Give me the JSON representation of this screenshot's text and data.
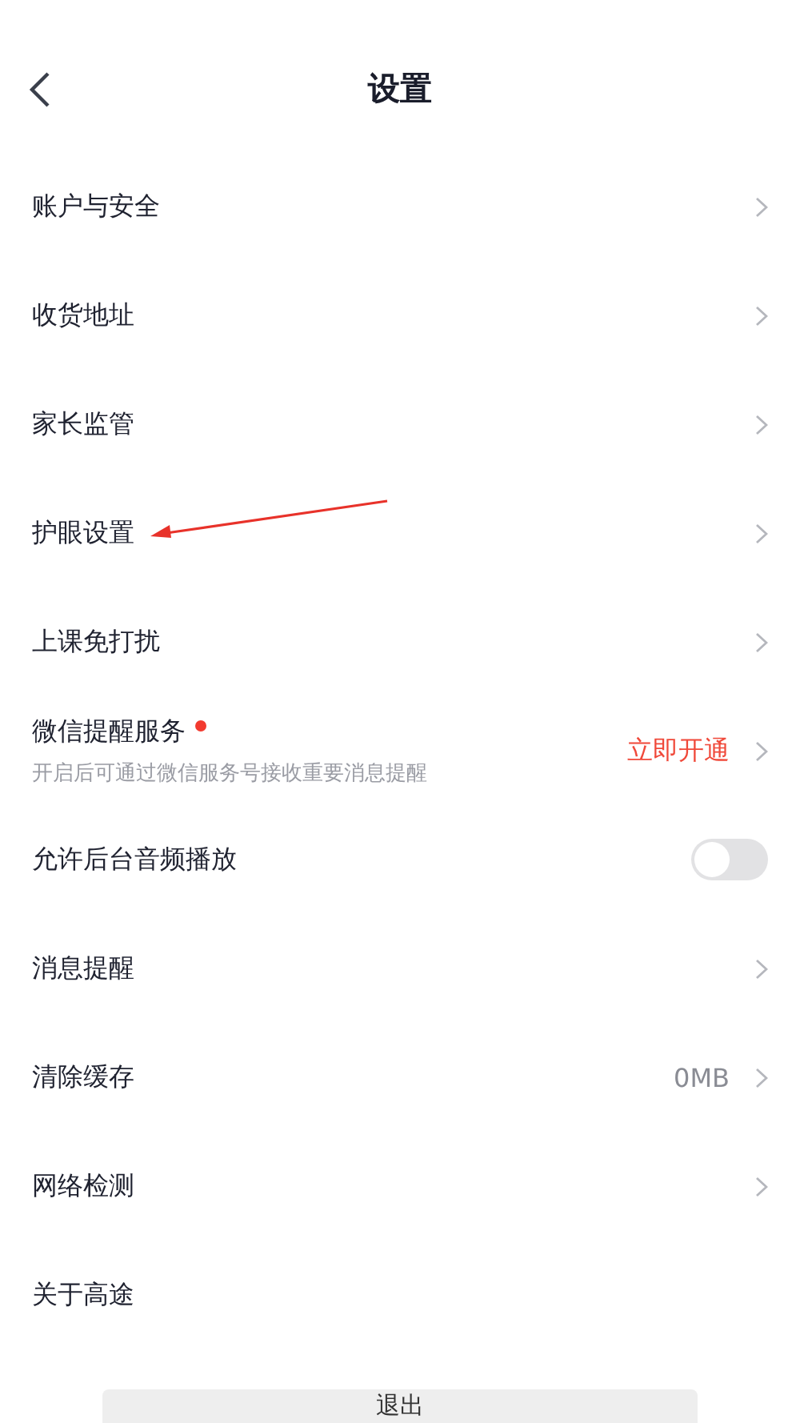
{
  "header": {
    "title": "设置"
  },
  "settings": [
    {
      "kind": "link",
      "label": "账户与安全"
    },
    {
      "kind": "link",
      "label": "收货地址"
    },
    {
      "kind": "link",
      "label": "家长监管"
    },
    {
      "kind": "link",
      "label": "护眼设置",
      "pointer_arrow": true
    },
    {
      "kind": "link",
      "label": "上课免打扰"
    },
    {
      "kind": "action",
      "label": "微信提醒服务",
      "dot": true,
      "hint": "开启后可通过微信服务号接收重要消息提醒",
      "action": "立即开通"
    },
    {
      "kind": "toggle",
      "label": "允许后台音频播放",
      "on": false
    },
    {
      "kind": "link",
      "label": "消息提醒"
    },
    {
      "kind": "value",
      "label": "清除缓存",
      "value": "0MB"
    },
    {
      "kind": "link",
      "label": "网络检测"
    },
    {
      "kind": "plain",
      "label": "关于高途"
    }
  ],
  "logout_button": {
    "label": "退出"
  }
}
